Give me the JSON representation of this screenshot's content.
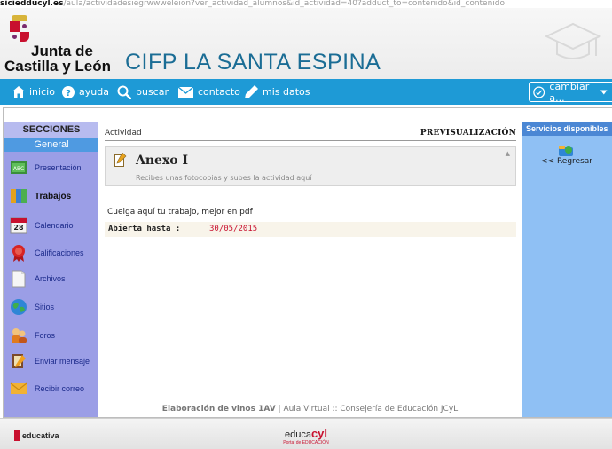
{
  "browser": {
    "url_bold": "siciedducyl.es",
    "url_rest": "/aula/actividadesiegrwwweleion?ver_actividad_alumnos&id_actividad=40?adduct_to=contenido&id_contenido"
  },
  "header": {
    "logo_line1": "Junta de",
    "logo_line2": "Castilla y León",
    "site_title": "CIFP LA SANTA ESPINA"
  },
  "nav": {
    "inicio": "inicio",
    "ayuda": "ayuda",
    "buscar": "buscar",
    "contacto": "contacto",
    "mis_datos": "mis datos",
    "cambiar": "cambiar a..."
  },
  "sidebar": {
    "heading": "SECCIONES",
    "subheading": "General",
    "items": [
      {
        "label": "Presentación",
        "icon": "presentation-icon"
      },
      {
        "label": "Trabajos",
        "icon": "assignments-icon"
      },
      {
        "label": "Calendario",
        "icon": "calendar-icon"
      },
      {
        "label": "Calificaciones",
        "icon": "grades-ribbon-icon"
      },
      {
        "label": "Archivos",
        "icon": "files-icon"
      },
      {
        "label": "Sitios",
        "icon": "globe-icon"
      },
      {
        "label": "Foros",
        "icon": "forum-icon"
      },
      {
        "label": "Enviar mensaje",
        "icon": "send-message-icon"
      },
      {
        "label": "Recibir correo",
        "icon": "envelope-icon"
      }
    ],
    "calendar_day": "28"
  },
  "content": {
    "section_label": "Actividad",
    "preview_label": "PREVISUALIZACIÓN",
    "activity_title": "Anexo I",
    "activity_subtitle": "Recibes unas fotocopias y subes la actividad aquí",
    "upload_text": "Cuelga aquí tu trabajo, mejor en pdf",
    "deadline_label": "Abierta hasta :",
    "deadline_date": "30/05/2015",
    "footer_course": "Elaboración de vinos 1AV",
    "footer_rest": " | Aula Virtual :: Consejería de Educación JCyL"
  },
  "right_panel": {
    "heading": "Servicios disponibles",
    "back_link": "<< Regresar"
  },
  "bottom": {
    "left_brand": "educativa",
    "center_brand_prefix": "educa",
    "center_brand_suffix": "cyl",
    "center_brand_sub": "Portal de EDUCACIÓN"
  },
  "colors": {
    "nav_blue": "#1e9ad6",
    "sidebar_purple": "#9b9ee6",
    "right_panel_blue": "#8fc0f4",
    "title_blue": "#1b6d95",
    "deadline_red": "#c8102e"
  }
}
